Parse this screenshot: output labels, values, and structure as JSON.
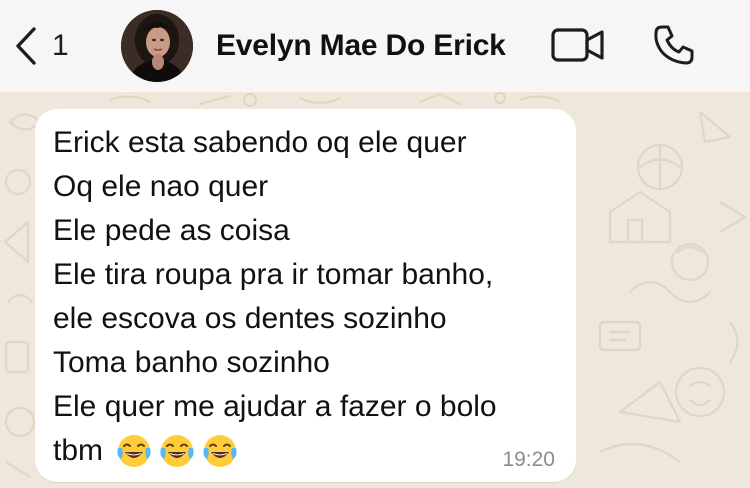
{
  "header": {
    "back_count": "1",
    "contact_name": "Evelyn Mae Do Erick",
    "icons": {
      "back": "chevron-left-icon",
      "video": "video-camera-icon",
      "call": "phone-icon"
    }
  },
  "message": {
    "lines": [
      "Erick esta sabendo oq ele quer",
      "Oq ele nao quer",
      "Ele pede as coisa",
      "Ele tira roupa pra ir tomar banho,",
      "ele escova os dentes sozinho",
      "Toma banho sozinho",
      "Ele quer me ajudar a fazer o bolo",
      "tbm"
    ],
    "emojis": [
      "face-with-tears-of-joy",
      "face-with-tears-of-joy",
      "face-with-tears-of-joy"
    ],
    "time": "19:20"
  },
  "colors": {
    "header_bg": "#f6f6f6",
    "chat_bg": "#efe7dc",
    "bubble_bg": "#ffffff",
    "timestamp": "#8c8c8c"
  }
}
